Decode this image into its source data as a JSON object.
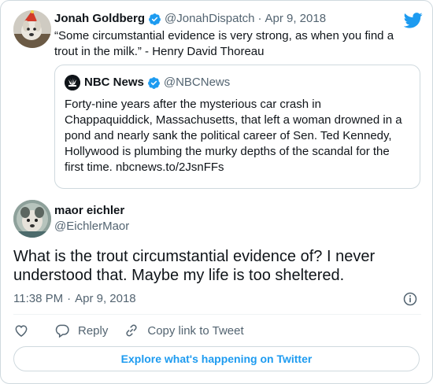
{
  "parent_tweet": {
    "author_name": "Jonah Goldberg",
    "handle": "@JonahDispatch",
    "separator": "·",
    "date": "Apr 9, 2018",
    "text": "“Some circumstantial evidence is very strong, as when you find a trout in the milk.” - Henry David Thoreau"
  },
  "quoted_tweet": {
    "author_name": "NBC News",
    "handle": "@NBCNews",
    "text": "Forty-nine years after the mysterious car crash in Chappaquiddick, Massachusetts, that left a woman drowned in a pond and nearly sank the political career of Sen. Ted Kennedy, Hollywood is plumbing the murky depths of the scandal for the first time. nbcnews.to/2JsnFFs"
  },
  "reply_tweet": {
    "author_name": "maor eichler",
    "handle": "@EichlerMaor",
    "text": "What is the trout circumstantial evidence of? I never understood that. Maybe my life is too sheltered.",
    "time": "11:38 PM",
    "separator": "·",
    "date": "Apr 9, 2018"
  },
  "actions": {
    "reply_label": "Reply",
    "copy_link_label": "Copy link to Tweet"
  },
  "explore_label": "Explore what's happening on Twitter",
  "icons": [
    "twitter-bird-icon",
    "verified-badge-icon",
    "nbc-peacock-icon",
    "info-icon",
    "heart-icon",
    "reply-icon",
    "link-icon"
  ],
  "colors": {
    "accent": "#1d9bf0",
    "text_primary": "#0f1419",
    "text_secondary": "#536471",
    "border": "#cfd9de"
  }
}
